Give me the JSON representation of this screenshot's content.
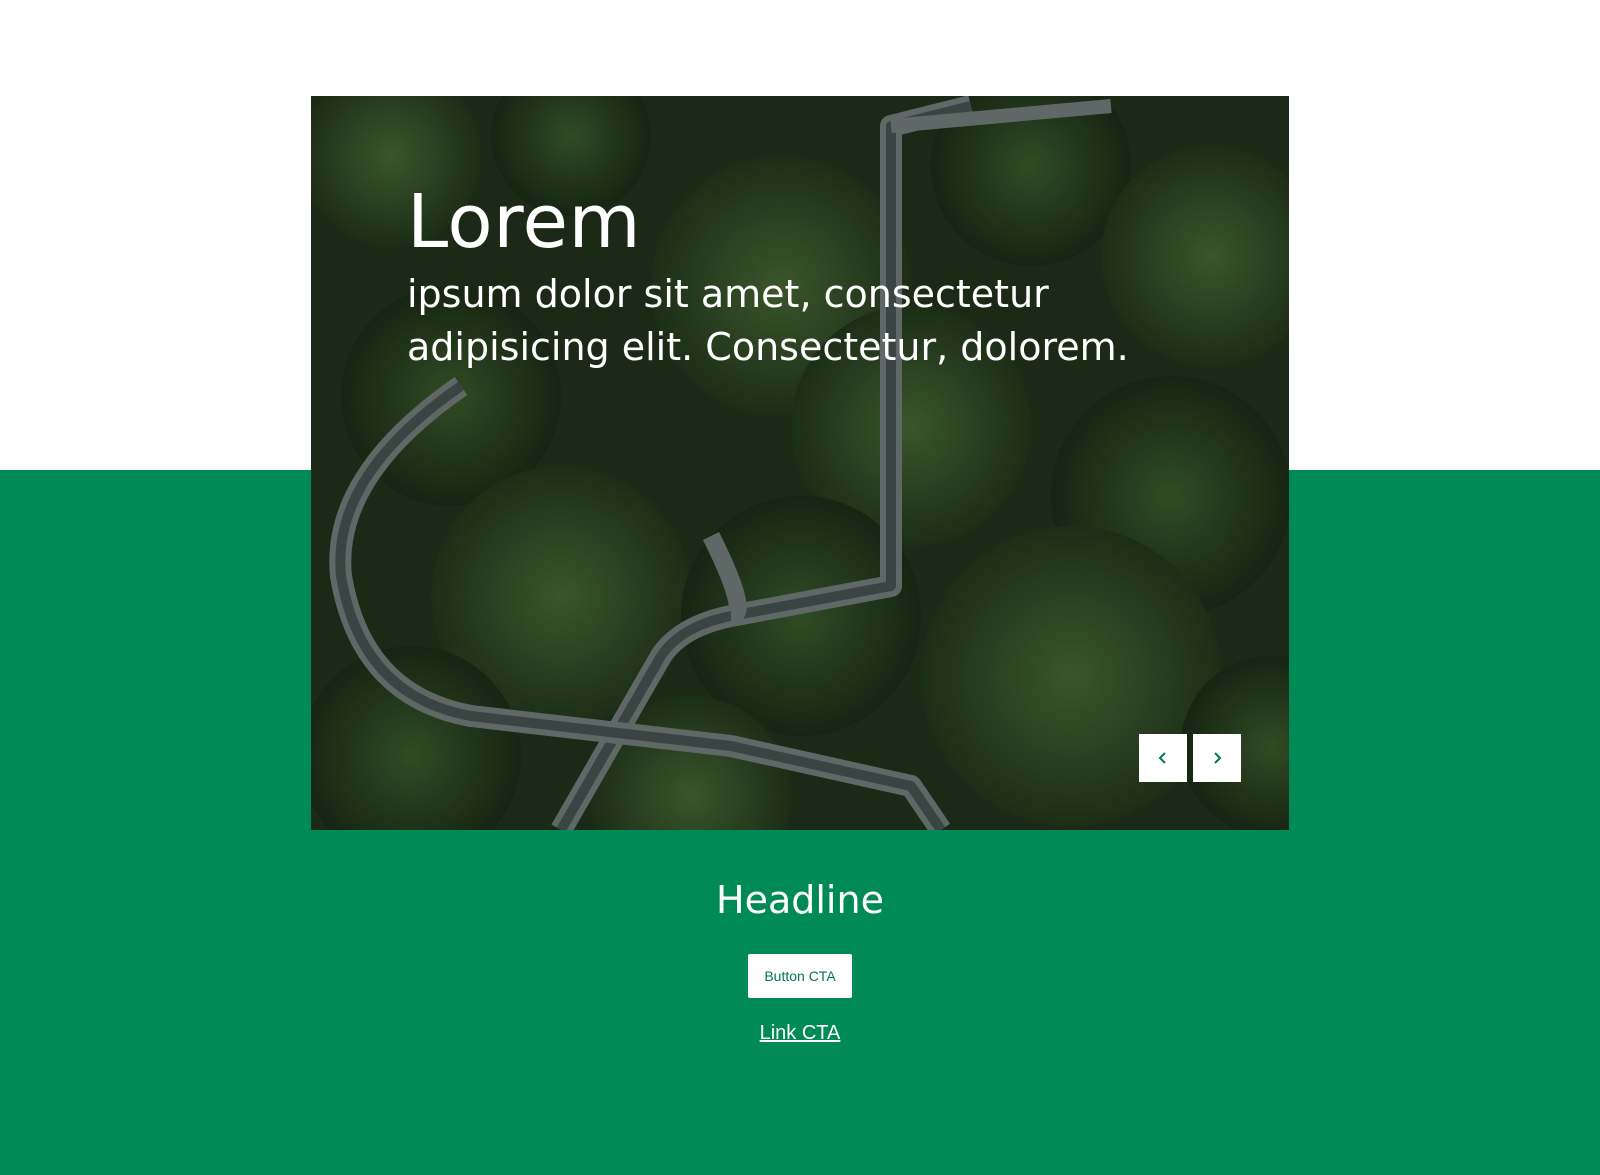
{
  "hero": {
    "title": "Lorem",
    "subtitle": "ipsum dolor sit amet, consectetur adipisicing elit. Consectetur, dolorem.",
    "image_description_icon": "forest-walkway-image",
    "controls": {
      "prev_icon": "chevron-left-icon",
      "next_icon": "chevron-right-icon"
    }
  },
  "section": {
    "headline": "Headline",
    "button_label": "Button CTA",
    "link_label": "Link CTA"
  },
  "colors": {
    "brand_green": "#008a56",
    "white": "#ffffff",
    "accent_text": "#007a4c"
  }
}
